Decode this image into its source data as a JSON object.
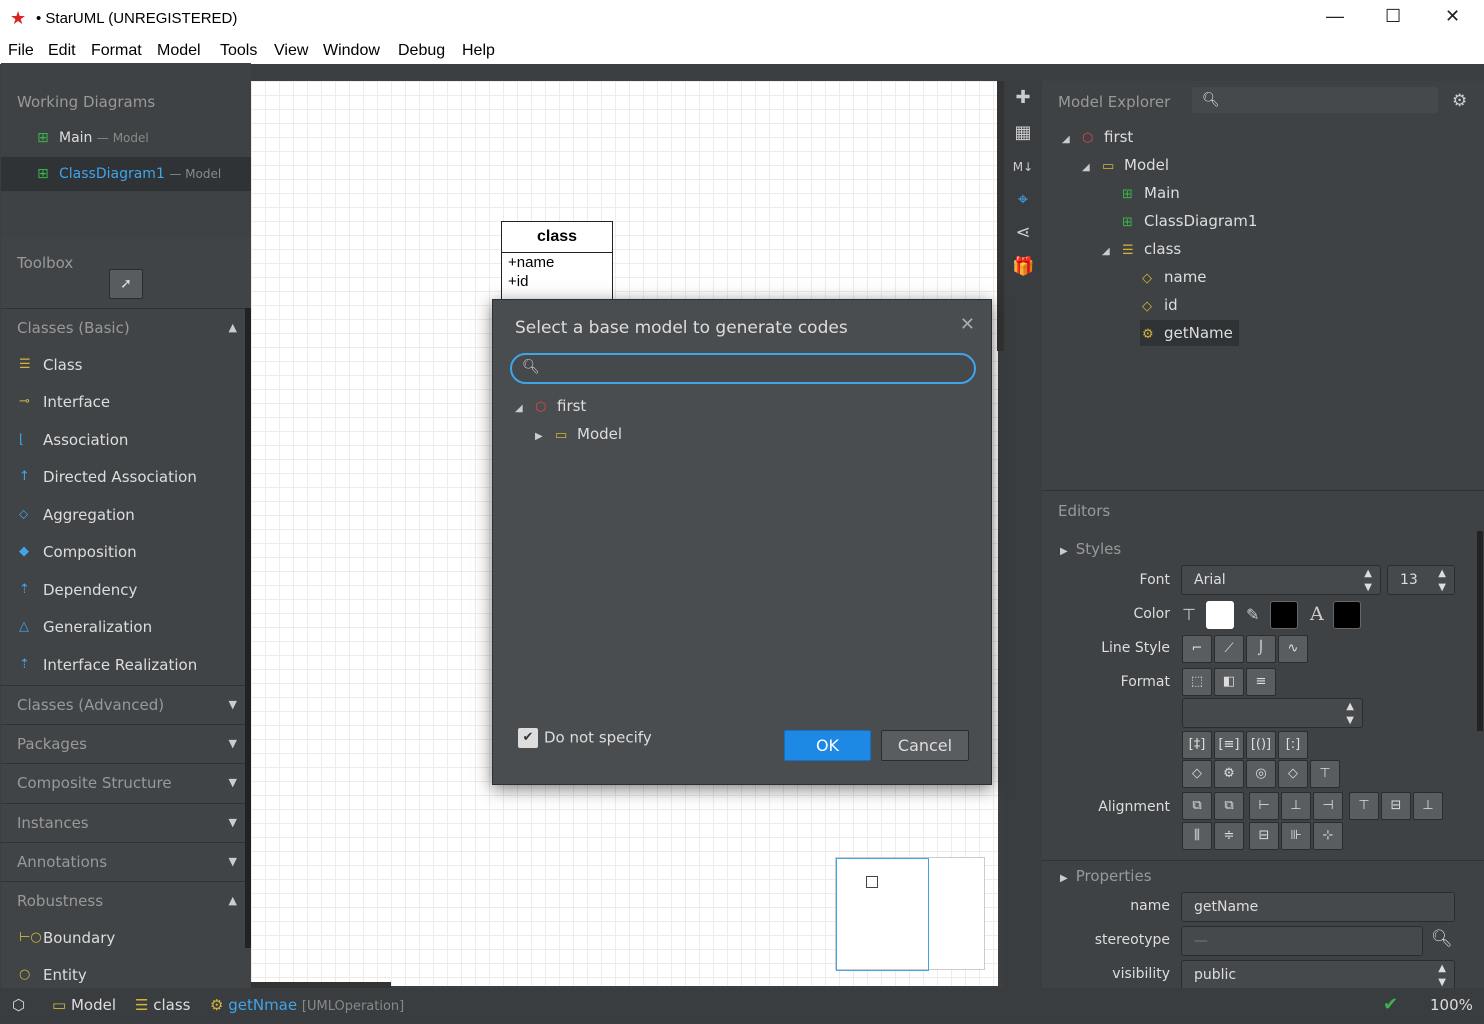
{
  "window": {
    "title": "• StarUML (UNREGISTERED)",
    "minimize": "—",
    "maximize": "☐",
    "close": "✕"
  },
  "menu": [
    "File",
    "Edit",
    "Format",
    "Model",
    "Tools",
    "View",
    "Window",
    "Debug",
    "Help"
  ],
  "working_diagrams": {
    "title": "Working Diagrams",
    "items": [
      {
        "label": "Main",
        "sub": "— Model"
      },
      {
        "label": "ClassDiagram1",
        "sub": "— Model"
      }
    ]
  },
  "toolbox": {
    "title": "Toolbox",
    "groups": {
      "classes_basic": "Classes (Basic)",
      "classes_advanced": "Classes (Advanced)",
      "packages": "Packages",
      "composite": "Composite Structure",
      "instances": "Instances",
      "annotations": "Annotations",
      "robustness": "Robustness"
    },
    "basic_items": [
      "Class",
      "Interface",
      "Association",
      "Directed Association",
      "Aggregation",
      "Composition",
      "Dependency",
      "Generalization",
      "Interface Realization"
    ],
    "robustness_items": [
      "Boundary",
      "Entity"
    ]
  },
  "diagram": {
    "class_name": "class",
    "attributes": [
      "+name",
      "+id"
    ]
  },
  "model_explorer": {
    "title": "Model Explorer",
    "tree": {
      "root": "first",
      "model": "Model",
      "main": "Main",
      "diagram": "ClassDiagram1",
      "class": "class",
      "attr1": "name",
      "attr2": "id",
      "op": "getName"
    }
  },
  "editors": {
    "title": "Editors",
    "styles": "Styles",
    "font_label": "Font",
    "font_value": "Arial",
    "font_size": "13",
    "color_label": "Color",
    "line_style_label": "Line Style",
    "format_label": "Format",
    "alignment_label": "Alignment",
    "fill_color": "#ffffff",
    "line_color": "#000000",
    "text_color": "#000000"
  },
  "properties": {
    "title": "Properties",
    "name_label": "name",
    "name_value": "getName",
    "stereotype_label": "stereotype",
    "stereotype_value": "—",
    "visibility_label": "visibility",
    "visibility_value": "public"
  },
  "dialog": {
    "title": "Select a base model to generate codes",
    "search_value": "",
    "tree_root": "first",
    "tree_child": "Model",
    "checkbox_label": "Do not specify",
    "checkbox_checked": true,
    "ok": "OK",
    "cancel": "Cancel"
  },
  "statusbar": {
    "crumb1": "Model",
    "crumb2": "class",
    "crumb3": "getNmae",
    "crumb3_type": "[UMLOperation]",
    "zoom": "100%"
  },
  "accent_color": "#1e88e5"
}
